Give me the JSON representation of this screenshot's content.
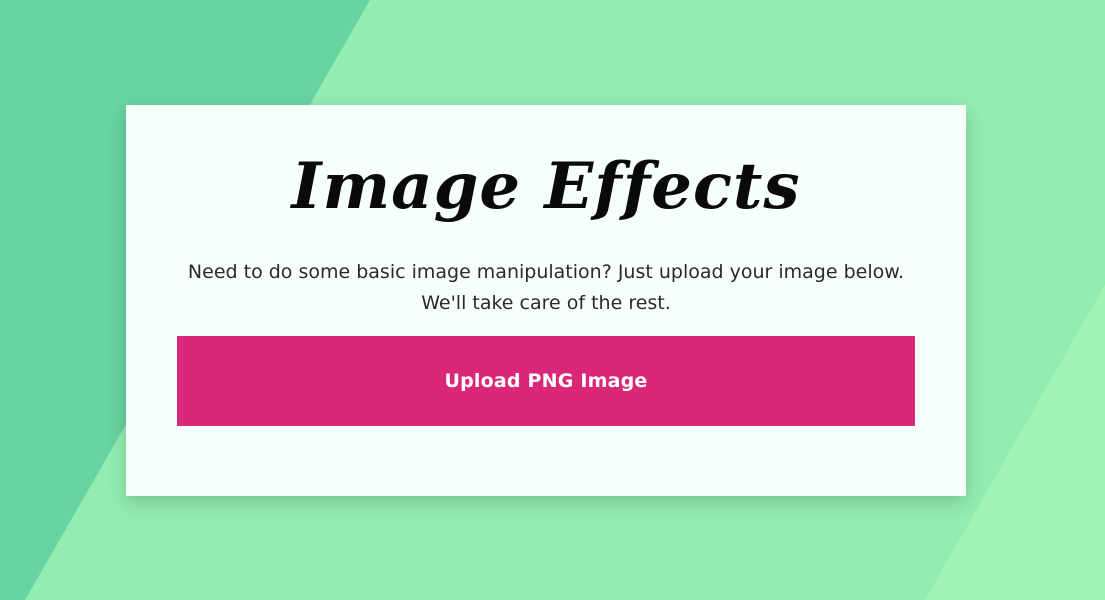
{
  "colors": {
    "background": "#92edb0",
    "background_dark_stripe": "#68d4a1",
    "background_light_stripe": "#a2f3b6",
    "card": "#f7fffa",
    "accent": "#db2777",
    "title_text": "#0a0a0a",
    "body_text": "#2a2a2a"
  },
  "card": {
    "title": "Image Effects",
    "description": "Need to do some basic image manipulation? Just upload your image below. We'll take care of the rest.",
    "upload_label": "Upload PNG Image"
  }
}
